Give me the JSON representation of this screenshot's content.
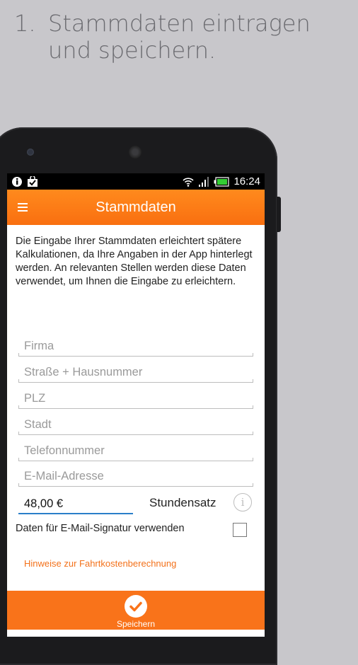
{
  "headline": {
    "number": "1.",
    "text": "Stammdaten eintragen\nund speichern."
  },
  "status_bar": {
    "time": "16:24"
  },
  "app_bar": {
    "title": "Stammdaten"
  },
  "intro_text": "Die Eingabe Ihrer Stammdaten erleichtert spätere Kalkulationen, da Ihre Angaben in der App hinterlegt werden. An relevanten Stellen werden diese Daten verwendet, um Ihnen die Eingabe zu erleichtern.",
  "fields": {
    "firma": {
      "placeholder": "Firma",
      "value": ""
    },
    "strasse": {
      "placeholder": "Straße + Hausnummer",
      "value": ""
    },
    "plz": {
      "placeholder": "PLZ",
      "value": ""
    },
    "stadt": {
      "placeholder": "Stadt",
      "value": ""
    },
    "telefon": {
      "placeholder": "Telefonnummer",
      "value": ""
    },
    "email": {
      "placeholder": "E-Mail-Adresse",
      "value": ""
    }
  },
  "rate": {
    "value": "48,00 €",
    "label": "Stundensatz",
    "info_glyph": "i"
  },
  "signature": {
    "label": "Daten für E-Mail-Signatur verwenden",
    "checked": false
  },
  "link_text": "Hinweise zur Fahrtkostenberechnung",
  "save": {
    "label": "Speichern"
  },
  "colors": {
    "accent": "#f9731a",
    "focus": "#2a7fc9"
  }
}
